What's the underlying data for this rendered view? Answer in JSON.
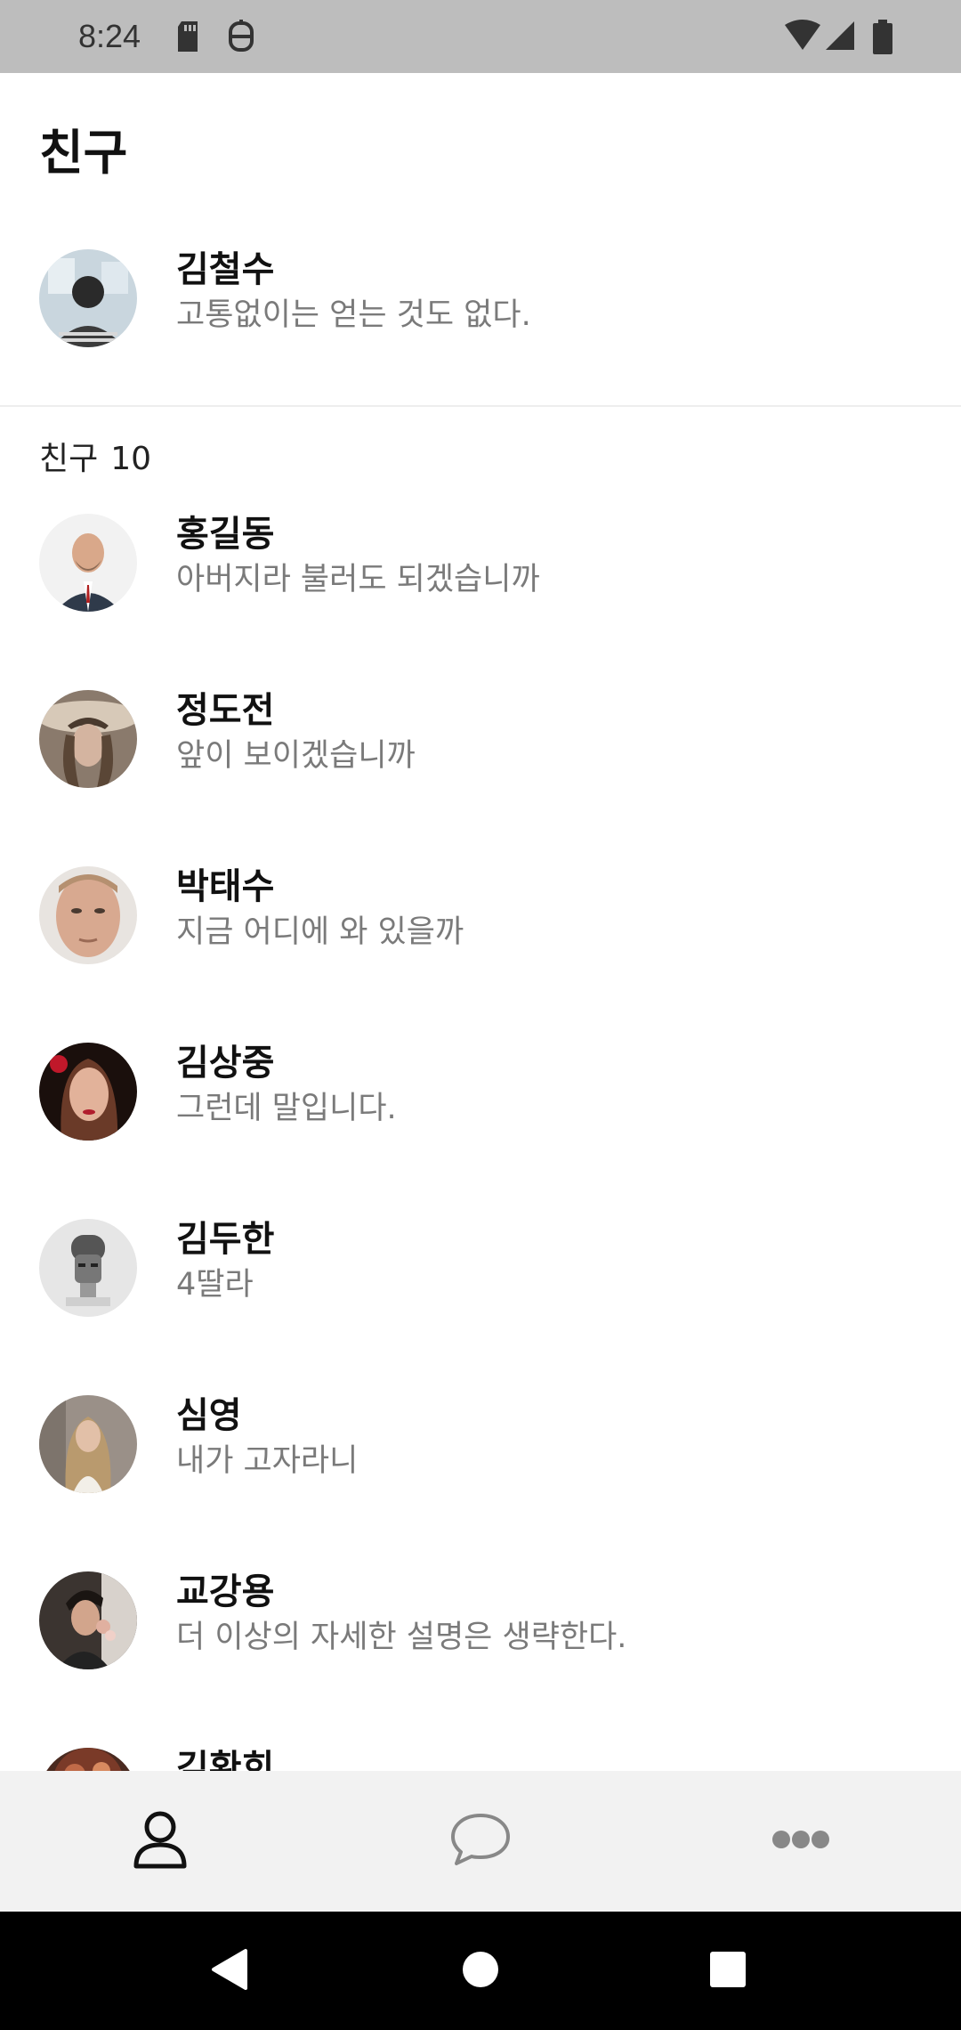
{
  "status_bar": {
    "time": "8:24",
    "icons": [
      "sd-card-icon",
      "notification-icon",
      "wifi-icon",
      "signal-icon",
      "battery-icon"
    ]
  },
  "header": {
    "title": "친구"
  },
  "my_profile": {
    "name": "김철수",
    "status": "고통없이는 얻는 것도 없다."
  },
  "section": {
    "label": "친구",
    "count": "10"
  },
  "friends": [
    {
      "name": "홍길동",
      "status": "아버지라 불러도 되겠습니까"
    },
    {
      "name": "정도전",
      "status": "앞이 보이겠습니까"
    },
    {
      "name": "박태수",
      "status": "지금 어디에 와 있을까"
    },
    {
      "name": "김상중",
      "status": "그런데 말입니다."
    },
    {
      "name": "김두한",
      "status": "4딸라"
    },
    {
      "name": "심영",
      "status": "내가 고자라니"
    },
    {
      "name": "교강용",
      "status": "더 이상의 자세한 설명은 생략한다."
    },
    {
      "name": "김환희",
      "status": ""
    }
  ],
  "tabs": [
    {
      "icon": "person-icon",
      "active": true
    },
    {
      "icon": "chat-bubble-icon",
      "active": false
    },
    {
      "icon": "more-icon",
      "active": false
    }
  ],
  "colors": {
    "status_bar": "#bdbdbd",
    "tab_bar": "#f2f2f2",
    "nav_bar": "#000000",
    "secondary_text": "#7a7a7a"
  }
}
